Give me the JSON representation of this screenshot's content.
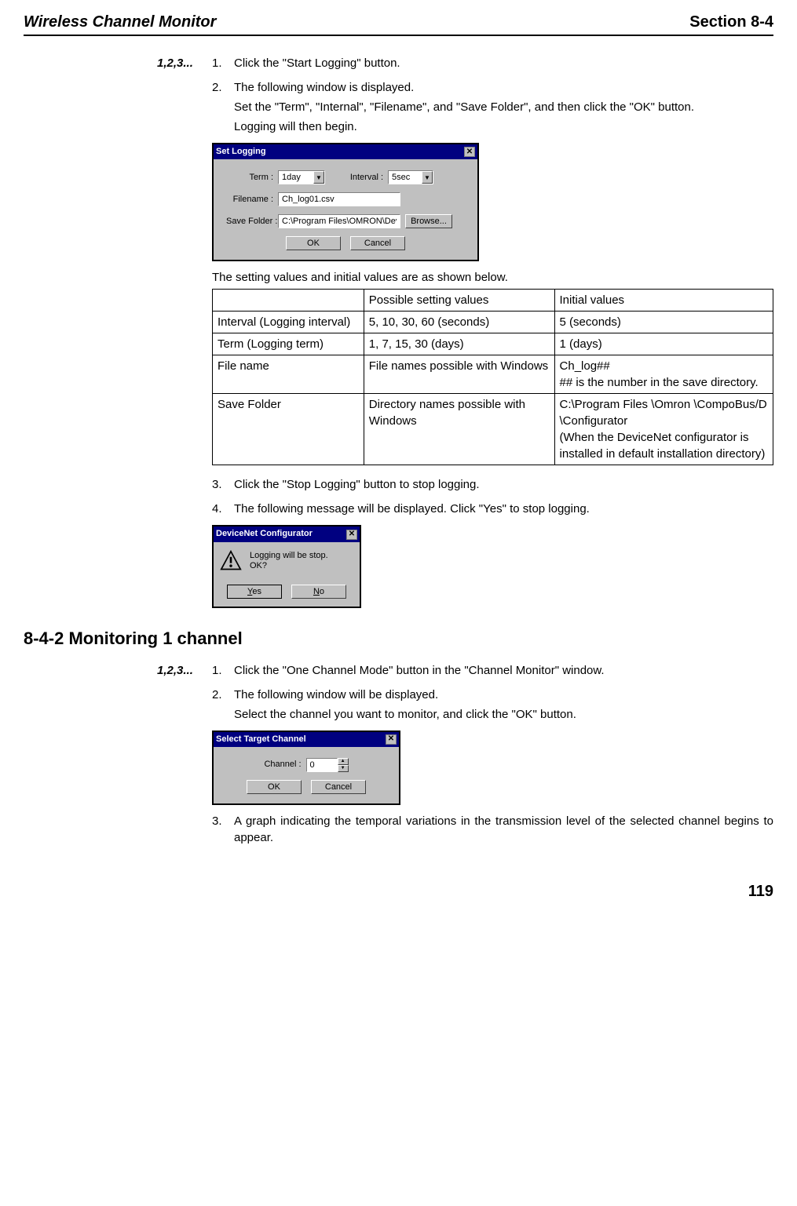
{
  "header": {
    "title": "Wireless Channel Monitor",
    "section": "Section 8-4"
  },
  "section1": {
    "label": "1,2,3...",
    "steps": [
      {
        "num": "1.",
        "text": "Click the \"Start Logging\" button."
      },
      {
        "num": "2.",
        "lines": [
          "The following window is displayed.",
          "Set the \"Term\", \"Internal\", \"Filename\", and \"Save Folder\", and then click the \"OK\" button.",
          "Logging will then begin."
        ]
      }
    ]
  },
  "setLogging": {
    "title": "Set Logging",
    "termLabel": "Term :",
    "termValue": "1day",
    "intervalLabel": "Interval :",
    "intervalValue": "5sec",
    "filenameLabel": "Filename :",
    "filenameValue": "Ch_log01.csv",
    "saveFolderLabel": "Save Folder :",
    "saveFolderValue": "C:\\Program Files\\OMRON\\Devic",
    "browse": "Browse...",
    "ok": "OK",
    "cancel": "Cancel"
  },
  "tableIntro": "The setting values and initial values are as shown below.",
  "table": {
    "h1": "",
    "h2": "Possible setting values",
    "h3": "Initial values",
    "rows": [
      {
        "c1": "Interval (Logging interval)",
        "c2": "5, 10, 30, 60 (seconds)",
        "c3": "5 (seconds)"
      },
      {
        "c1": "Term (Logging term)",
        "c2": "1, 7, 15, 30 (days)",
        "c3": "1 (days)"
      },
      {
        "c1": "File name",
        "c2": "File names possible with Windows",
        "c3": "Ch_log##\n## is the number in the save directory."
      },
      {
        "c1": "Save Folder",
        "c2": "Directory names possible with Windows",
        "c3": "C:\\Program Files \\Omron \\CompoBus/D \\Configurator\n(When the DeviceNet configurator is installed in default installation directory)"
      }
    ]
  },
  "section1b": {
    "step3": {
      "num": "3.",
      "text": "Click the \"Stop Logging\" button to stop logging."
    },
    "step4": {
      "num": "4.",
      "text": "The following message will be displayed. Click \"Yes\" to stop logging."
    }
  },
  "confirmDialog": {
    "title": "DeviceNet Configurator",
    "msg1": "Logging will be stop.",
    "msg2": "OK?",
    "yes": "Yes",
    "no": "No"
  },
  "heading842": "8-4-2    Monitoring 1 channel",
  "section2": {
    "label": "1,2,3...",
    "step1": {
      "num": "1.",
      "text": "Click the \"One Channel Mode\" button in the \"Channel Monitor\" window."
    },
    "step2": {
      "num": "2.",
      "lines": [
        "The following window will be displayed.",
        "Select the channel you want to monitor, and click the \"OK\" button."
      ]
    }
  },
  "selectChannel": {
    "title": "Select Target Channel",
    "channelLabel": "Channel :",
    "channelValue": "0",
    "ok": "OK",
    "cancel": "Cancel"
  },
  "section2b": {
    "step3": {
      "num": "3.",
      "text": "A graph indicating the temporal variations in the transmission level of the selected channel begins to appear."
    }
  },
  "pageNum": "119"
}
